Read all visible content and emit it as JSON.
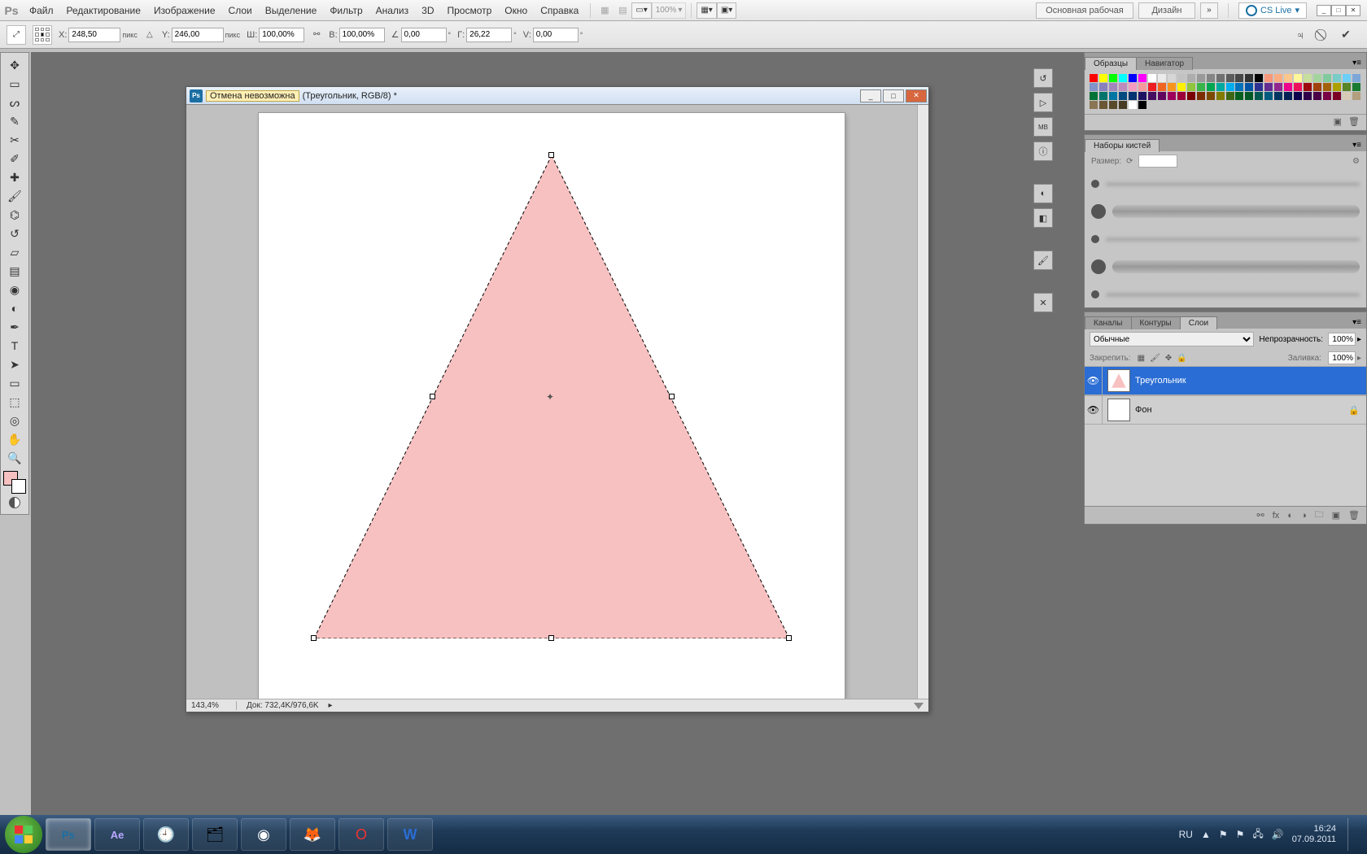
{
  "app_logo": "Ps",
  "menu": [
    "Файл",
    "Редактирование",
    "Изображение",
    "Слои",
    "Выделение",
    "Фильтр",
    "Анализ",
    "3D",
    "Просмотр",
    "Окно",
    "Справка"
  ],
  "menubar_right": {
    "zoom_dd": "100%",
    "workspace_a": "Основная рабочая среда",
    "workspace_b": "Дизайн",
    "cslive": "CS Live"
  },
  "optbar": {
    "x_label": "X:",
    "x": "248,50",
    "x_unit": "пикс",
    "y_label": "Y:",
    "y": "246,00",
    "y_unit": "пикс",
    "w_label": "Ш:",
    "w": "100,00%",
    "h_label": "В:",
    "h": "100,00%",
    "ang_label": "∠",
    "ang": "0,00",
    "ang_unit": "°",
    "hskew_label": "Г:",
    "hskew": "26,22",
    "hskew_unit": "°",
    "vskew_label": "V:",
    "vskew": "0,00",
    "vskew_unit": "°"
  },
  "docwin": {
    "hint": "Отмена невозможна",
    "title": "(Треугольник, RGB/8) *",
    "zoom": "143,4%",
    "docsize": "Док: 732,4K/976,6K"
  },
  "panels": {
    "swatches_tabs": [
      "Образцы",
      "Навигатор"
    ],
    "brushes_tab": "Наборы кистей",
    "brushes_size_label": "Размер:",
    "layers_tabs": [
      "Каналы",
      "Контуры",
      "Слои"
    ],
    "layers_blend": "Обычные",
    "layers_opacity_label": "Непрозрачность:",
    "layers_opacity": "100%",
    "layers_lock_label": "Закрепить:",
    "layers_fill_label": "Заливка:",
    "layers_fill": "100%",
    "layer1": "Треугольник",
    "layer2": "Фон"
  },
  "swatch_colors": [
    "#ff0000",
    "#ffff00",
    "#00ff00",
    "#00ffff",
    "#0000ff",
    "#ff00ff",
    "#ffffff",
    "#ebebeb",
    "#d6d6d6",
    "#c2c2c2",
    "#adadad",
    "#999999",
    "#858585",
    "#707070",
    "#5c5c5c",
    "#474747",
    "#333333",
    "#000000",
    "#f7977a",
    "#fbad82",
    "#fdc68c",
    "#fff799",
    "#c6df9c",
    "#a4d49d",
    "#81ca9d",
    "#7accc8",
    "#6ccff7",
    "#7da7d9",
    "#8293ca",
    "#8881be",
    "#a286bd",
    "#bc8cbf",
    "#f49bc1",
    "#f5999d",
    "#ee1d24",
    "#f16522",
    "#f7941d",
    "#fff100",
    "#8fc63d",
    "#37b44a",
    "#00a650",
    "#00a99e",
    "#00aeef",
    "#0072bc",
    "#0054a5",
    "#2f3192",
    "#652c91",
    "#91278f",
    "#ed008c",
    "#ee105a",
    "#9d0a0f",
    "#a1410d",
    "#a36209",
    "#aba000",
    "#588528",
    "#197b30",
    "#007236",
    "#00736a",
    "#0076a4",
    "#004a80",
    "#003370",
    "#1d1363",
    "#450e61",
    "#62055f",
    "#9e005c",
    "#9d0039",
    "#7a0000",
    "#7b2e00",
    "#7c4900",
    "#817b00",
    "#3e6617",
    "#045f20",
    "#005824",
    "#005951",
    "#005b7e",
    "#003562",
    "#002056",
    "#0d004c",
    "#30004a",
    "#4b0048",
    "#7a0045",
    "#7a0026",
    "#d8cbb6",
    "#b29f7e",
    "#8a7654",
    "#6a5735",
    "#594a2c",
    "#473b24",
    "#ffffff",
    "#000000"
  ],
  "taskbar": {
    "lang": "RU",
    "time": "16:24",
    "date": "07.09.2011"
  }
}
